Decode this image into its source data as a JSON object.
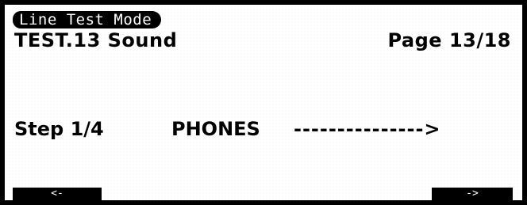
{
  "header": {
    "mode_label": "Line Test Mode",
    "test_title": "TEST.13 Sound",
    "page_indicator": "Page 13/18"
  },
  "step_line": {
    "step": "Step 1/4",
    "device": "PHONES",
    "arrow": "--------------->"
  },
  "softkeys": {
    "left_label": "<-",
    "right_label": "->"
  }
}
